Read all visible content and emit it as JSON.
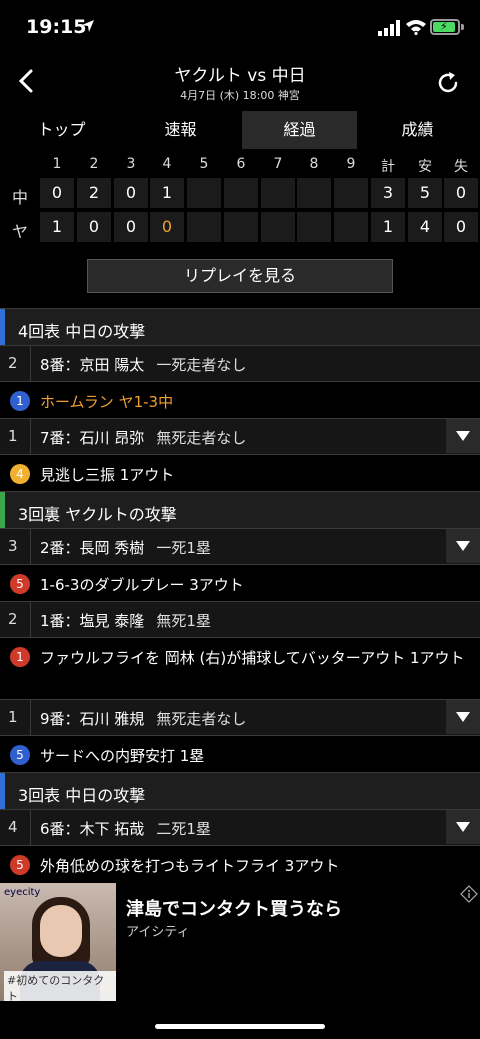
{
  "status": {
    "time": "19:15"
  },
  "header": {
    "title": "ヤクルト vs 中日",
    "subtitle": "4月7日 (木) 18:00 神宮"
  },
  "tabs": [
    {
      "label": "トップ"
    },
    {
      "label": "速報"
    },
    {
      "label": "経過",
      "active": true
    },
    {
      "label": "成績"
    }
  ],
  "scoreboard": {
    "headers": [
      "1",
      "2",
      "3",
      "4",
      "5",
      "6",
      "7",
      "8",
      "9",
      "計",
      "安",
      "失"
    ],
    "teams": [
      {
        "label": "中",
        "innings": [
          "0",
          "2",
          "0",
          "1",
          "",
          "",
          "",
          "",
          ""
        ],
        "totals": [
          "3",
          "5",
          "0"
        ]
      },
      {
        "label": "ヤ",
        "innings": [
          "1",
          "0",
          "0",
          "0",
          "",
          "",
          "",
          "",
          ""
        ],
        "totals": [
          "1",
          "4",
          "0"
        ]
      }
    ]
  },
  "replay_label": "リプレイを見る",
  "feed": [
    {
      "type": "inning",
      "text": "4回表 中日の攻撃",
      "color": "#2f6fd6"
    },
    {
      "type": "batter",
      "num": "2",
      "name": "8番：京田 陽太",
      "situation": "一死走者なし",
      "expand": false
    },
    {
      "type": "play",
      "badge": "1",
      "badge_color": "#2f5fd0",
      "text": "ホームラン ヤ1-3中",
      "highlight": true
    },
    {
      "type": "batter",
      "num": "1",
      "name": "7番：石川 昂弥",
      "situation": "無死走者なし",
      "expand": true
    },
    {
      "type": "play",
      "badge": "4",
      "badge_color": "#f0b030",
      "text": "見逃し三振 1アウト"
    },
    {
      "type": "inning",
      "text": "3回裏 ヤクルトの攻撃",
      "color": "#3aa84a"
    },
    {
      "type": "batter",
      "num": "3",
      "name": "2番：長岡 秀樹",
      "situation": "一死1塁",
      "expand": true
    },
    {
      "type": "play",
      "badge": "5",
      "badge_color": "#d03a2a",
      "text": "1-6-3のダブルプレー 3アウト"
    },
    {
      "type": "batter",
      "num": "2",
      "name": "1番：塩見 泰隆",
      "situation": "無死1塁",
      "expand": false
    },
    {
      "type": "play",
      "badge": "1",
      "badge_color": "#d03a2a",
      "text": "ファウルフライを 岡林 (右)が捕球してバッターアウト 1アウト",
      "tall": true
    },
    {
      "type": "batter",
      "num": "1",
      "name": "9番：石川 雅規",
      "situation": "無死走者なし",
      "expand": true
    },
    {
      "type": "play",
      "badge": "5",
      "badge_color": "#2f5fd0",
      "text": "サードへの内野安打 1塁"
    },
    {
      "type": "inning",
      "text": "3回表 中日の攻撃",
      "color": "#2f6fd6"
    },
    {
      "type": "batter",
      "num": "4",
      "name": "6番：木下 拓哉",
      "situation": "二死1塁",
      "expand": true
    },
    {
      "type": "play",
      "badge": "5",
      "badge_color": "#d03a2a",
      "text": "外角低めの球を打つもライトフライ 3アウト"
    }
  ],
  "ad": {
    "brand": "eyecity",
    "image_caption": "#初めてのコンタクト",
    "title": "津島でコンタクト買うなら",
    "subtitle": "アイシティ"
  },
  "colors": {
    "highlight": "#f0a030"
  }
}
